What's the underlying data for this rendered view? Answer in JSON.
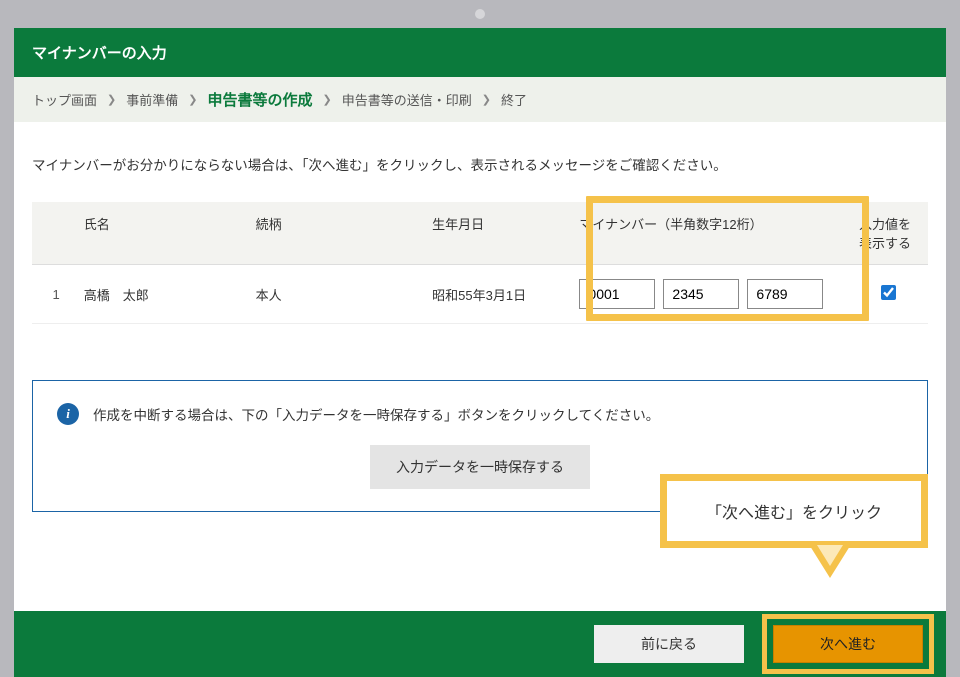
{
  "header": {
    "title": "マイナンバーの入力"
  },
  "breadcrumb": {
    "items": [
      "トップ画面",
      "事前準備"
    ],
    "current": "申告書等の作成",
    "after": [
      "申告書等の送信・印刷",
      "終了"
    ]
  },
  "instructions": "マイナンバーがお分かりにならない場合は、「次へ進む」をクリックし、表示されるメッセージをご確認ください。",
  "table": {
    "headers": {
      "name": "氏名",
      "relation": "続柄",
      "dob": "生年月日",
      "mynumber": "マイナンバー（半角数字12桁）",
      "showvalue": "入力値を表示する"
    },
    "rows": [
      {
        "num": "1",
        "name": "高橋　太郎",
        "relation": "本人",
        "dob": "昭和55年3月1日",
        "mn1": "0001",
        "mn2": "2345",
        "mn3": "6789",
        "show": true
      }
    ]
  },
  "info": {
    "text": "作成を中断する場合は、下の「入力データを一時保存する」ボタンをクリックしてください。",
    "save_label": "入力データを一時保存する"
  },
  "callout": {
    "text": "「次へ進む」をクリック"
  },
  "footer": {
    "back": "前に戻る",
    "next": "次へ進む"
  }
}
